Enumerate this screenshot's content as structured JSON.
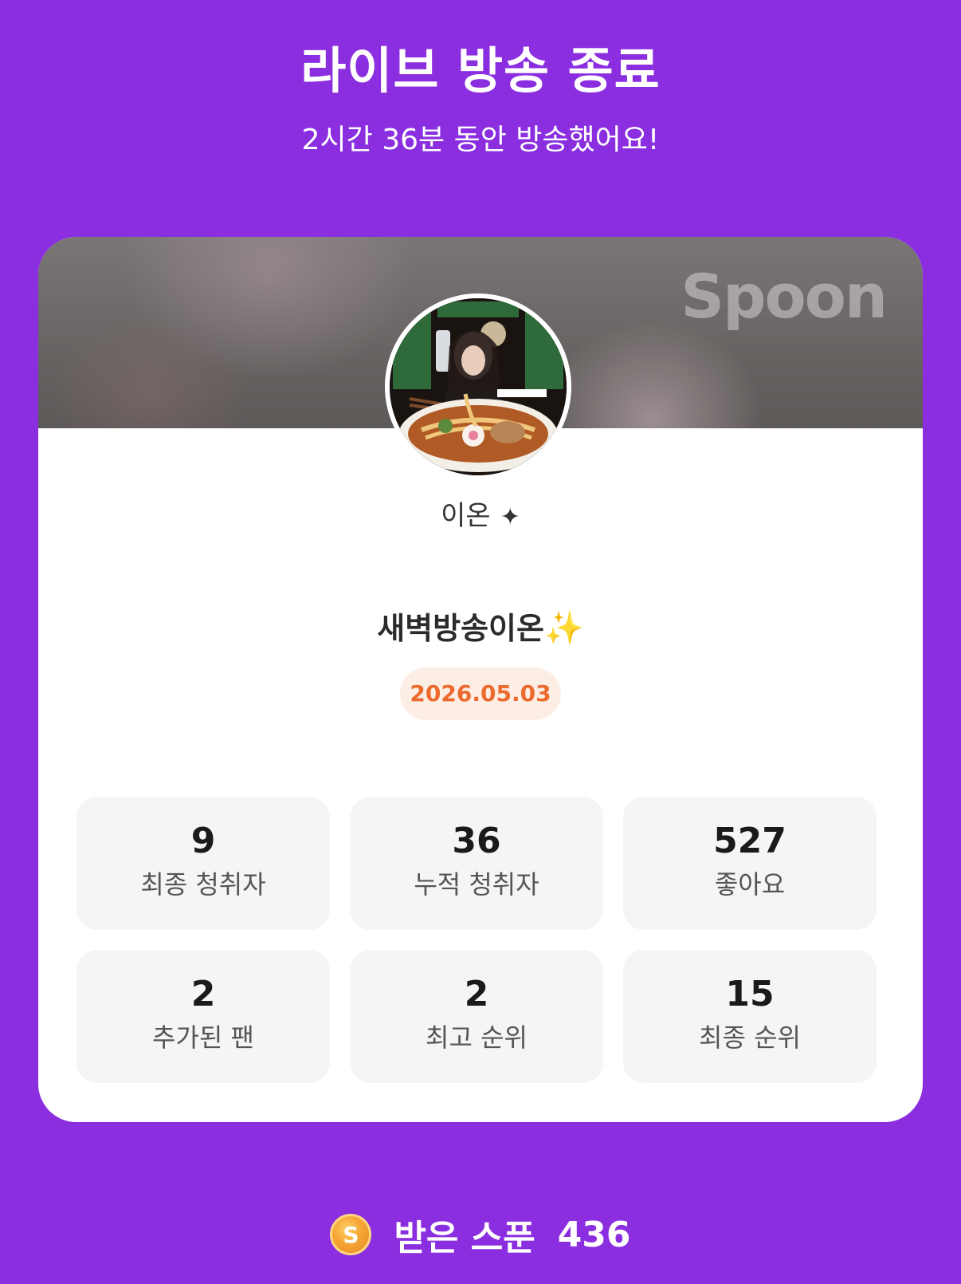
{
  "header": {
    "title": "라이브 방송 종료",
    "subtitle": "2시간 36분 동안 방송했어요!"
  },
  "card": {
    "brand": "Spoon",
    "host_name": "이온",
    "host_name_icon": "sparkle-icon",
    "live_title": "새벽방송이온",
    "live_title_emoji": "✨",
    "date": "2026.05.03",
    "stats": [
      {
        "value": "9",
        "label": "최종 청취자"
      },
      {
        "value": "36",
        "label": "누적 청취자"
      },
      {
        "value": "527",
        "label": "좋아요"
      },
      {
        "value": "2",
        "label": "추가된 팬"
      },
      {
        "value": "2",
        "label": "최고 순위"
      },
      {
        "value": "15",
        "label": "최종 순위"
      }
    ]
  },
  "footer": {
    "coin_letter": "S",
    "label": "받은 스푼",
    "value": "436"
  },
  "colors": {
    "background": "#8a2ee0",
    "date_text": "#ec6a2d",
    "date_badge_bg": "#fdeee5",
    "stat_bg": "#f5f5f5"
  }
}
